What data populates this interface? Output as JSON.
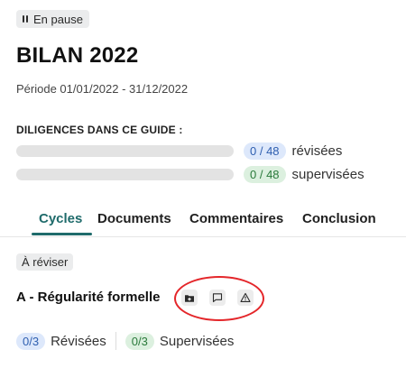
{
  "status": {
    "label": "En pause",
    "icon": "pause-icon"
  },
  "title": "BILAN 2022",
  "period": "Période 01/01/2022 - 31/12/2022",
  "diligences": {
    "heading": "DILIGENCES DANS CE GUIDE :",
    "rows": [
      {
        "count": "0 / 48",
        "label": "révisées",
        "progress_pct": 0,
        "color": "blue"
      },
      {
        "count": "0 / 48",
        "label": "supervisées",
        "progress_pct": 0,
        "color": "green"
      }
    ]
  },
  "tabs": [
    {
      "label": "Cycles",
      "active": true
    },
    {
      "label": "Documents",
      "active": false
    },
    {
      "label": "Commentaires",
      "active": false
    },
    {
      "label": "Conclusion",
      "active": false
    }
  ],
  "section": {
    "status_tag": "À réviser",
    "cycle_title": "A - Régularité formelle",
    "actions": [
      {
        "icon": "folder-add-icon"
      },
      {
        "icon": "comment-icon"
      },
      {
        "icon": "warning-icon"
      }
    ],
    "summary": [
      {
        "count": "0/3",
        "label": "Révisées",
        "color": "blue"
      },
      {
        "count": "0/3",
        "label": "Supervisées",
        "color": "green"
      }
    ]
  },
  "colors": {
    "accent": "#1f6b6b",
    "annotation": "#e4262a",
    "blue_pill_bg": "#dde8fb",
    "green_pill_bg": "#dcf0df"
  }
}
